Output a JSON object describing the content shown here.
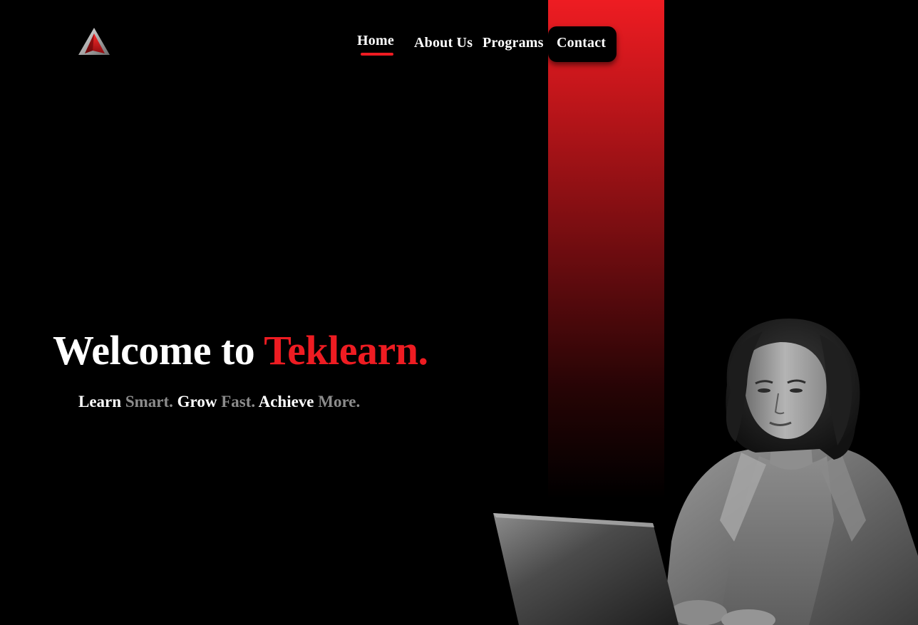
{
  "brand": {
    "logo_icon": "triangle-logo-icon",
    "accent_color": "#ee1c22"
  },
  "nav": {
    "items": [
      {
        "label": "Home",
        "active": true
      },
      {
        "label": "About Us",
        "active": false
      },
      {
        "label": "Programs",
        "active": false
      },
      {
        "label": "Contact",
        "active": false
      }
    ]
  },
  "hero": {
    "title_prefix": "Welcome to",
    "title_brand": "Teklearn.",
    "tagline": {
      "learn": "Learn",
      "smart": "Smart.",
      "grow": "Grow",
      "fast": "Fast.",
      "achieve": "Achieve",
      "more": "More."
    },
    "illustration_icon": "woman-with-laptop-photo"
  },
  "colors": {
    "background": "#000000",
    "accent": "#ee1c22",
    "muted_text": "#8c8c8c",
    "text": "#ffffff"
  }
}
